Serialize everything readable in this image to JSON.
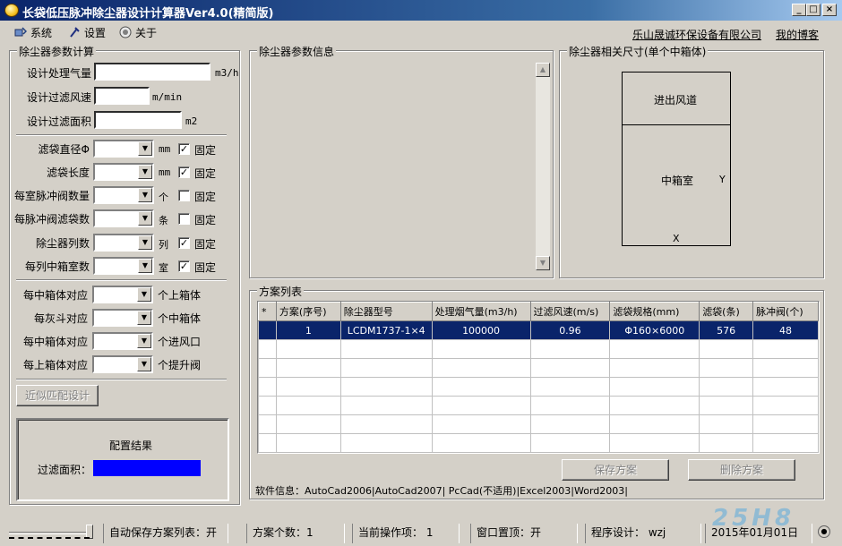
{
  "window": {
    "title": "长袋低压脉冲除尘器设计计算器Ver4.0(精简版)",
    "min_btn": "_",
    "max_btn": "□",
    "close_btn": "×"
  },
  "menu": {
    "items": [
      {
        "label": "系统",
        "icon": "system-icon"
      },
      {
        "label": "设置",
        "icon": "settings-icon"
      },
      {
        "label": "关于",
        "icon": "about-icon"
      }
    ],
    "company_link": "乐山晟诚环保设备有限公司",
    "blog_link": "我的博客"
  },
  "left_panel": {
    "title": "除尘器参数计算",
    "air_volume_label": "设计处理气量",
    "air_volume_value": "",
    "air_volume_unit": "m3/h",
    "filter_speed_label": "设计过滤风速",
    "filter_speed_value": "",
    "filter_speed_unit": "m/min",
    "filter_area_label": "设计过滤面积",
    "filter_area_value": "",
    "filter_area_unit": "m2",
    "bag_diameter_label": "滤袋直径Φ",
    "bag_diameter_unit": "mm",
    "bag_length_label": "滤袋长度",
    "bag_length_unit": "mm",
    "valves_per_room_label": "每室脉冲阀数量",
    "valves_per_room_unit": "个",
    "bags_per_valve_label": "每脉冲阀滤袋数",
    "bags_per_valve_unit": "条",
    "columns_label": "除尘器列数",
    "columns_unit": "列",
    "rooms_per_column_label": "每列中箱室数",
    "rooms_per_column_unit": "室",
    "fixed_label": "固定",
    "fixed_states": [
      true,
      true,
      false,
      false,
      true,
      true
    ],
    "upper_box_label": "每中箱体对应",
    "upper_box_unit": "个上箱体",
    "hopper_label": "每灰斗对应",
    "hopper_unit": "个中箱体",
    "inlet_label": "每中箱体对应",
    "inlet_unit": "个进风口",
    "lift_valve_label": "每上箱体对应",
    "lift_valve_unit": "个提升阀",
    "match_button": "近似匹配设计",
    "result_title": "配置结果",
    "result_area_label": "过滤面积：",
    "result_area_color": "#0000ff"
  },
  "info_panel": {
    "title": "除尘器参数信息"
  },
  "dim_panel": {
    "title": "除尘器相关尺寸(单个中箱体)",
    "duct_label": "进出风道",
    "room_label": "中箱室",
    "y_label": "Y",
    "x_label": "X"
  },
  "plan_panel": {
    "title": "方案列表",
    "columns": [
      "*",
      "方案(序号)",
      "除尘器型号",
      "处理烟气量(m3/h)",
      "过滤风速(m/s)",
      "滤袋规格(mm)",
      "滤袋(条)",
      "脉冲阀(个)"
    ],
    "rows": [
      [
        "",
        "1",
        "LCDM1737-1×4",
        "100000",
        "0.96",
        "Φ160×6000",
        "576",
        "48"
      ]
    ],
    "empty_rows": 6,
    "save_button": "保存方案",
    "delete_button": "删除方案",
    "software_info": "软件信息：AutoCad2006|AutoCad2007| PcCad(不适用)|Excel2003|Word2003|"
  },
  "status": {
    "auto_save": "自动保存方案列表：开",
    "plan_count": "方案个数：1",
    "current_op": "当前操作项： 1",
    "on_top": "窗口置顶：开",
    "designer": "程序设计： wzj",
    "date": "2015年01月01日",
    "watermark": "25H8"
  }
}
